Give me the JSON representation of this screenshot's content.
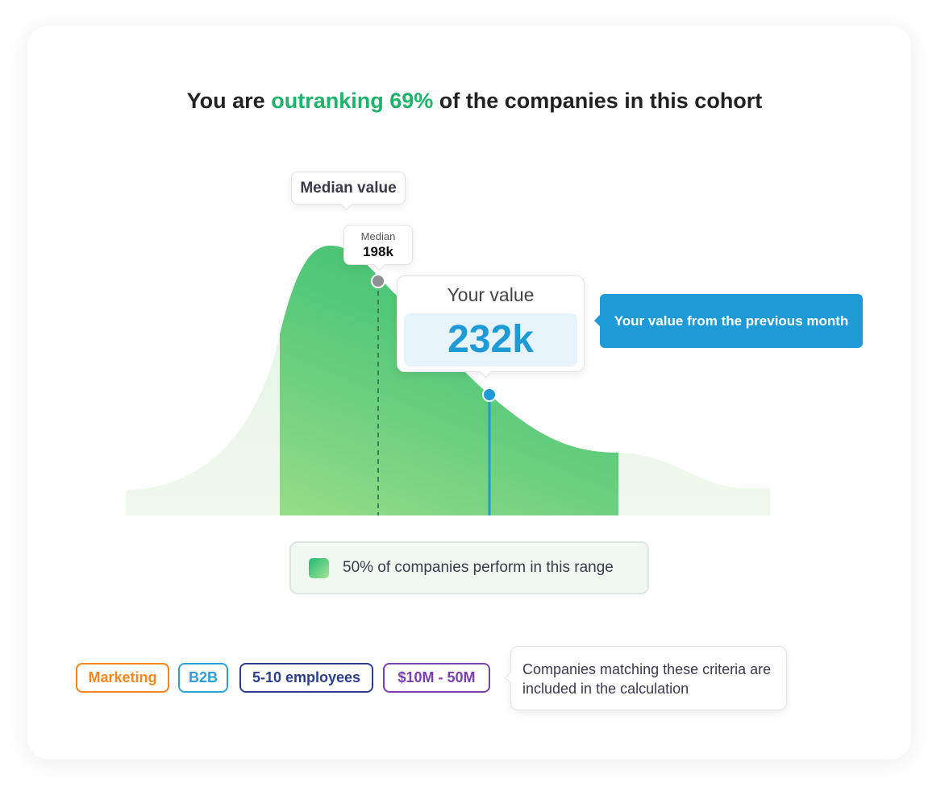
{
  "title": {
    "prefix": "You are ",
    "highlight": "outranking 69%",
    "suffix": " of the companies in this cohort",
    "highlight_color": "#1db36b"
  },
  "chart_data": {
    "type": "area",
    "title": "You are outranking 69% of the companies in this cohort",
    "median": {
      "annotation": "Median value",
      "label": "Median",
      "value": "198k"
    },
    "your_value": {
      "label": "Your value",
      "value": "232k",
      "color": "#1e9ad6"
    },
    "previous_month": {
      "label": "Your value from the previous month"
    },
    "range_legend": {
      "label": "50% of companies perform in this range",
      "share_percent": 50
    },
    "percentile": 69
  },
  "filters": {
    "tags": [
      {
        "label": "Marketing",
        "color": "#f5871f"
      },
      {
        "label": "B2B",
        "color": "#2a9fd8"
      },
      {
        "label": "5-10 employees",
        "color": "#2c3e8c"
      },
      {
        "label": "$10M - 50M",
        "color": "#7b3fb0"
      }
    ],
    "note": "Companies matching these criteria are included in the calculation"
  }
}
